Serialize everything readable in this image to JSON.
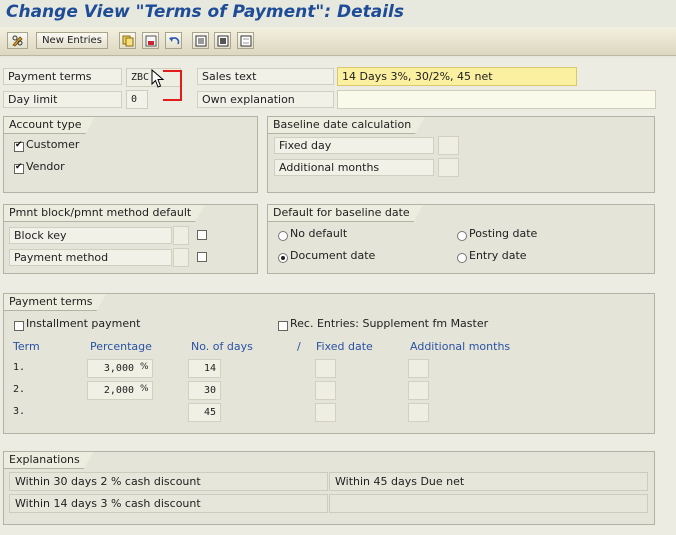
{
  "header": {
    "title": "Change View \"Terms of Payment\": Details"
  },
  "toolbar": {
    "new_entries_label": "New Entries"
  },
  "top": {
    "payment_terms_label": "Payment terms",
    "payment_terms_value": "ZBC",
    "sales_text_label": "Sales text",
    "sales_text_value": "14 Days 3%, 30/2%, 45 net",
    "day_limit_label": "Day limit",
    "day_limit_value": "0",
    "own_explanation_label": "Own explanation",
    "own_explanation_value": ""
  },
  "account_type": {
    "title": "Account type",
    "customer_label": "Customer",
    "vendor_label": "Vendor",
    "customer_checked": true,
    "vendor_checked": true
  },
  "baseline_calc": {
    "title": "Baseline date calculation",
    "fixed_day_label": "Fixed day",
    "additional_months_label": "Additional months"
  },
  "pmnt_block": {
    "title": "Pmnt block/pmnt method default",
    "block_key_label": "Block key",
    "payment_method_label": "Payment method"
  },
  "default_baseline": {
    "title": "Default for baseline date",
    "no_default_label": "No default",
    "posting_date_label": "Posting date",
    "document_date_label": "Document date",
    "entry_date_label": "Entry date",
    "selected": "Document date"
  },
  "payment_terms": {
    "title": "Payment terms",
    "installment_label": "Installment payment",
    "rec_entries_label": "Rec. Entries: Supplement fm Master",
    "col_term": "Term",
    "col_percentage": "Percentage",
    "col_days": "No. of days",
    "col_slash": "/",
    "col_fixed_date": "Fixed date",
    "col_additional_months": "Additional months",
    "rows": [
      {
        "term": "1.",
        "percentage": "3,000",
        "unit": "%",
        "days": "14"
      },
      {
        "term": "2.",
        "percentage": "2,000",
        "unit": "%",
        "days": "30"
      },
      {
        "term": "3.",
        "percentage": "",
        "unit": "",
        "days": "45"
      }
    ]
  },
  "explanations": {
    "title": "Explanations",
    "line1_left": "Within 30 days 2 % cash discount",
    "line1_right": "Within 45 days Due net",
    "line2_left": "Within 14 days 3 % cash discount",
    "line2_right": ""
  },
  "colors": {
    "title": "#1e4c97",
    "sales_text_bg": "#faf0a0",
    "column_header": "#2a52a5"
  }
}
